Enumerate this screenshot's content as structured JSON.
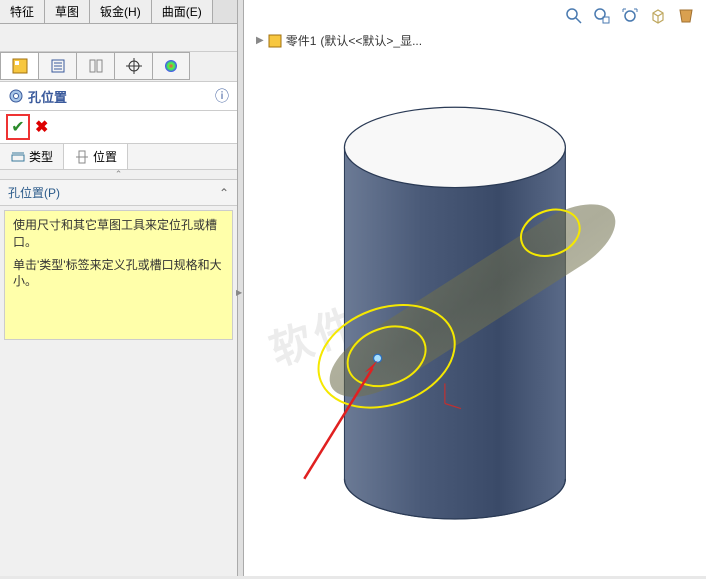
{
  "top_tabs": {
    "feature": "特征",
    "sketch": "草图",
    "sheetmetal": "钣金(H)",
    "surface": "曲面(E)"
  },
  "panel_title": "孔位置",
  "sub_tabs": {
    "type": "类型",
    "position": "位置"
  },
  "section_header": "孔位置(P)",
  "hint_line1": "使用尺寸和其它草图工具来定位孔或槽口。",
  "hint_line2": "单击'类型'标签来定义孔或槽口规格和大小。",
  "breadcrumb": {
    "part": "零件1",
    "state": "(默认<<默认>_显..."
  },
  "watermark": "软件自学网",
  "icons": {
    "feature_tree": "feature-tree-icon",
    "property": "detail-icon",
    "config": "config-icon",
    "crosshair": "crosshair-icon",
    "appearance": "appearance-icon",
    "hole": "hole-icon",
    "help": "help-icon",
    "ok": "ok-check",
    "cancel": "cancel-x",
    "type_tab": "type-icon",
    "position_tab": "position-icon",
    "zoom": "zoom-icon",
    "zoom_area": "zoom-area-icon",
    "zoom_fit": "zoom-fit-icon",
    "view_cube": "view-cube-icon",
    "palette": "palette-icon"
  }
}
